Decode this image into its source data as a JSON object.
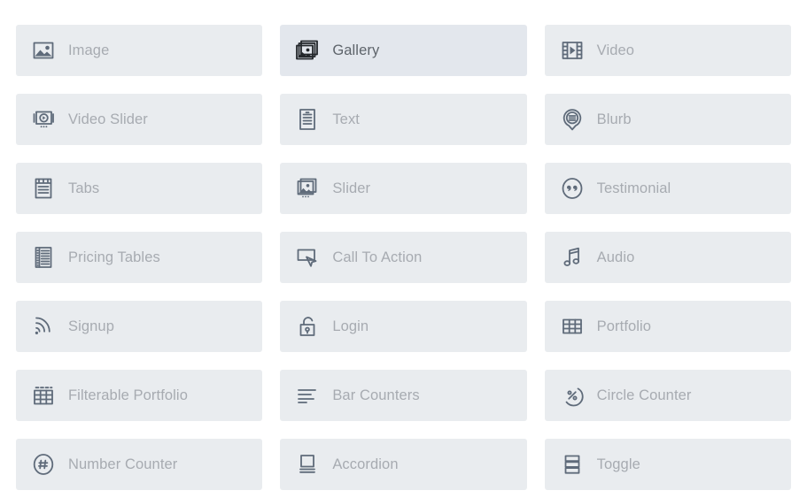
{
  "page": {
    "background_color": "#ffffff",
    "card_color": "#e9ecef",
    "card_active_color": "#e3e7ed",
    "icon_color": "#5f6b7a",
    "icon_active_color": "#23272b",
    "label_color": "#a7abb1",
    "label_active_color": "#5e646b",
    "columns": 3
  },
  "modules": [
    {
      "label": "Image",
      "icon": "image-icon",
      "active": false
    },
    {
      "label": "Gallery",
      "icon": "gallery-icon",
      "active": true
    },
    {
      "label": "Video",
      "icon": "video-icon",
      "active": false
    },
    {
      "label": "Video Slider",
      "icon": "video-slider-icon",
      "active": false
    },
    {
      "label": "Text",
      "icon": "text-icon",
      "active": false
    },
    {
      "label": "Blurb",
      "icon": "blurb-icon",
      "active": false
    },
    {
      "label": "Tabs",
      "icon": "tabs-icon",
      "active": false
    },
    {
      "label": "Slider",
      "icon": "slider-icon",
      "active": false
    },
    {
      "label": "Testimonial",
      "icon": "testimonial-icon",
      "active": false
    },
    {
      "label": "Pricing Tables",
      "icon": "pricing-tables-icon",
      "active": false
    },
    {
      "label": "Call To Action",
      "icon": "call-to-action-icon",
      "active": false
    },
    {
      "label": "Audio",
      "icon": "audio-icon",
      "active": false
    },
    {
      "label": "Signup",
      "icon": "signup-icon",
      "active": false
    },
    {
      "label": "Login",
      "icon": "login-icon",
      "active": false
    },
    {
      "label": "Portfolio",
      "icon": "portfolio-icon",
      "active": false
    },
    {
      "label": "Filterable Portfolio",
      "icon": "filterable-portfolio-icon",
      "active": false
    },
    {
      "label": "Bar Counters",
      "icon": "bar-counters-icon",
      "active": false
    },
    {
      "label": "Circle Counter",
      "icon": "circle-counter-icon",
      "active": false
    },
    {
      "label": "Number Counter",
      "icon": "number-counter-icon",
      "active": false
    },
    {
      "label": "Accordion",
      "icon": "accordion-icon",
      "active": false
    },
    {
      "label": "Toggle",
      "icon": "toggle-icon",
      "active": false
    }
  ]
}
